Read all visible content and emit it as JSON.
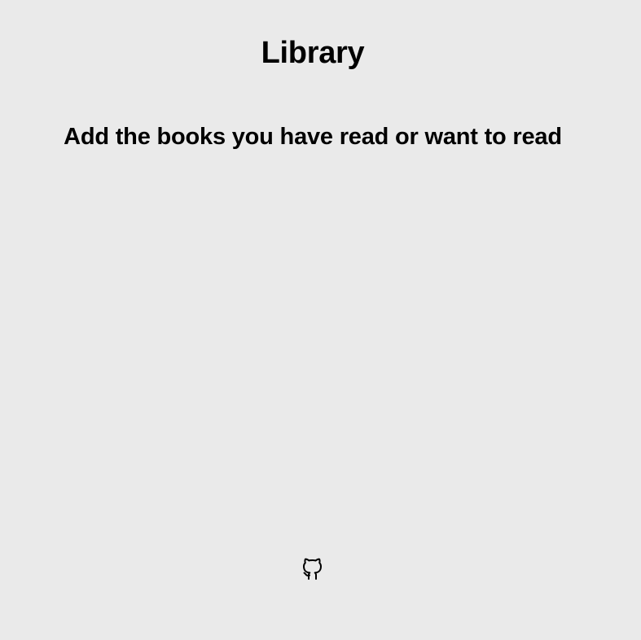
{
  "header": {
    "title": "Library"
  },
  "intro": {
    "subtitle": "Add the books you have read or want to read"
  },
  "library": {
    "books": []
  },
  "footer": {
    "icon": "github-icon"
  }
}
